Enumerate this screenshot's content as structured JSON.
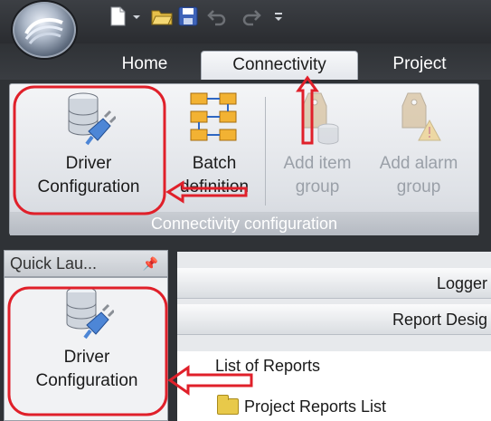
{
  "quick_access": {
    "icons": [
      "new-document-icon",
      "dropdown-arrow-icon",
      "open-folder-icon",
      "save-icon",
      "undo-icon",
      "redo-icon",
      "customize-arrow-icon"
    ]
  },
  "tabs": [
    {
      "label": "Home",
      "active": false
    },
    {
      "label": "Connectivity",
      "active": true
    },
    {
      "label": "Project",
      "active": false
    }
  ],
  "ribbon": {
    "buttons": [
      {
        "line1": "Driver",
        "line2": "Configuration",
        "icon": "driver-configuration-icon",
        "enabled": true
      },
      {
        "line1": "Batch",
        "line2": "definition",
        "icon": "batch-definition-icon",
        "enabled": true
      },
      {
        "line1": "Add item",
        "line2": "group",
        "icon": "add-item-group-icon",
        "enabled": false
      },
      {
        "line1": "Add alarm",
        "line2": "group",
        "icon": "add-alarm-group-icon",
        "enabled": false
      }
    ],
    "group_label": "Connectivity configuration"
  },
  "quick_launch": {
    "title": "Quick Lau...",
    "pin_icon": "pin-icon",
    "item": {
      "line1": "Driver",
      "line2": "Configuration",
      "icon": "driver-configuration-icon"
    }
  },
  "main": {
    "slots": [
      "Logger",
      "Report Desig"
    ],
    "list_title": "List of Reports",
    "tree_item": "Project Reports List"
  },
  "annotation_color": "#e0202a"
}
